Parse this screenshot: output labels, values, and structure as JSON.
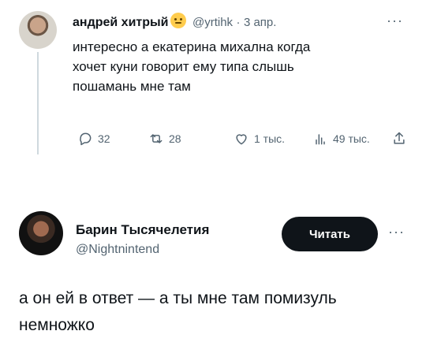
{
  "tweet1": {
    "author_name": "андрей хитрый",
    "handle": "@yrtihk",
    "separator": "·",
    "date": "3 апр.",
    "more": "···",
    "text_lines": [
      "интересно а екатерина михална когда",
      "хочет куни говорит ему типа слышь",
      "пошамань мне там"
    ],
    "stats": {
      "replies": "32",
      "retweets": "28",
      "likes": "1 тыс.",
      "views": "49 тыс."
    }
  },
  "tweet2": {
    "author_name": "Барин Тысячелетия",
    "handle": "@Nightnintend",
    "follow_label": "Читать",
    "more": "···",
    "text_lines": [
      "а он ей в ответ — а ты мне там помизуль",
      "немножко"
    ]
  }
}
